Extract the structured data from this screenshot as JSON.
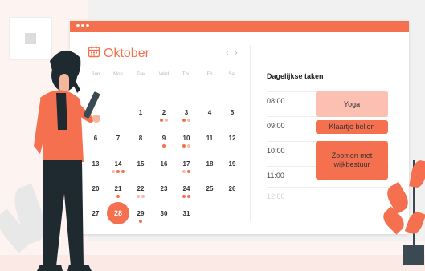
{
  "calendar": {
    "month": "Oktober",
    "prev_icon": "‹",
    "next_icon": "›",
    "weekdays": [
      "Sun",
      "Mon",
      "Tue",
      "Wed",
      "Thu",
      "Fri",
      "Sat"
    ],
    "weeks": [
      [
        "",
        "",
        "1",
        "2",
        "3",
        "4",
        "5"
      ],
      [
        "6",
        "7",
        "8",
        "9",
        "10",
        "11",
        "12"
      ],
      [
        "13",
        "14",
        "15",
        "16",
        "17",
        "18",
        "19"
      ],
      [
        "20",
        "21",
        "22",
        "23",
        "24",
        "25",
        "26"
      ],
      [
        "27",
        "28",
        "29",
        "30",
        "31",
        "",
        ""
      ]
    ],
    "today": "28"
  },
  "tasks": {
    "title": "Dagelijkse taken",
    "times": [
      "08:00",
      "09:00",
      "10:00",
      "11:00",
      "12:00"
    ],
    "items": [
      {
        "label": "Yoga"
      },
      {
        "label": "Klaartje bellen"
      },
      {
        "label": "Zoomen met wijkbestuur"
      }
    ]
  },
  "colors": {
    "accent": "#f5704f",
    "accent_light": "#fbb9a8",
    "text": "#333333"
  }
}
